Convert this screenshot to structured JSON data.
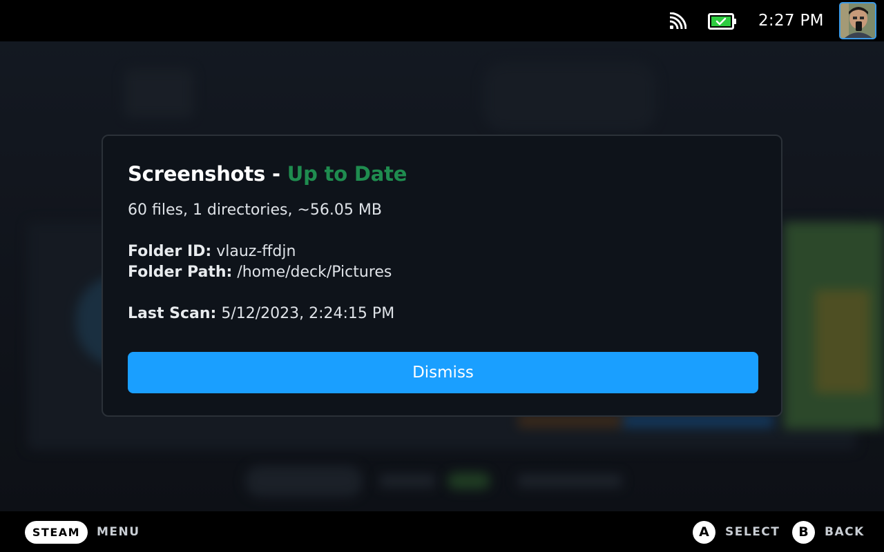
{
  "status_bar": {
    "clock": "2:27 PM",
    "icons": [
      "cast-icon",
      "battery-charging-icon",
      "user-avatar"
    ],
    "battery_color": "#2ecc40"
  },
  "dialog": {
    "title": "Screenshots -",
    "status": "Up to Date",
    "status_color": "#1f8c4f",
    "summary": "60 files, 1 directories, ~56.05 MB",
    "folder_id_label": "Folder ID:",
    "folder_id_value": "vlauz-ffdjn",
    "folder_path_label": "Folder Path:",
    "folder_path_value": "/home/deck/Pictures",
    "last_scan_label": "Last Scan:",
    "last_scan_value": "5/12/2023, 2:24:15 PM",
    "dismiss_label": "Dismiss",
    "accent": "#1a9fff"
  },
  "footer": {
    "steam_label": "STEAM",
    "menu_label": "MENU",
    "a_glyph": "A",
    "select_label": "SELECT",
    "b_glyph": "B",
    "back_label": "BACK"
  }
}
